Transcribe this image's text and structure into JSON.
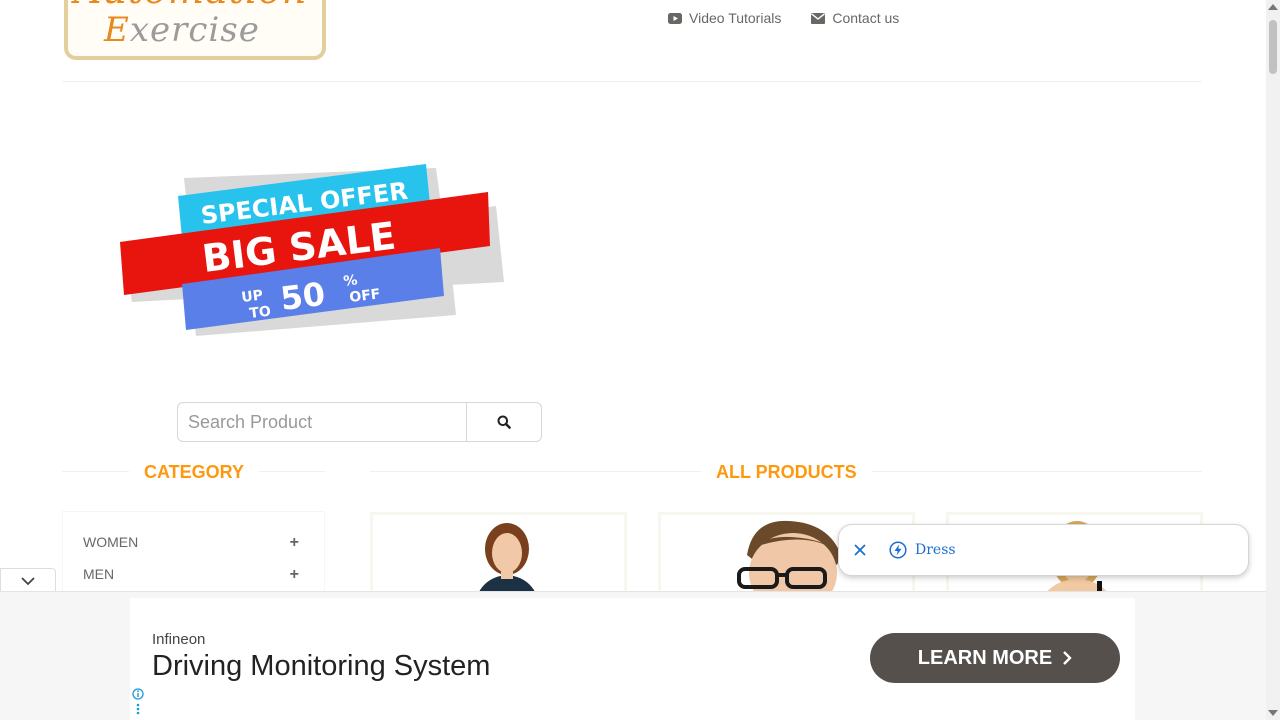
{
  "logo": {
    "line1": "Automation",
    "line2_cap": "E",
    "line2_rest": "xercise"
  },
  "nav": [
    {
      "label": "Video Tutorials",
      "icon": "youtube-icon"
    },
    {
      "label": "Contact us",
      "icon": "envelope-icon"
    }
  ],
  "banner": {
    "line1": "SPECIAL OFFER",
    "line2": "BIG SALE",
    "up": "UP",
    "to": "TO",
    "percent_value": "50",
    "percent_sign": "%",
    "off": "OFF"
  },
  "search": {
    "placeholder": "Search Product",
    "value": ""
  },
  "category": {
    "title": "CATEGORY",
    "items": [
      {
        "label": "WOMEN",
        "toggle": "+"
      },
      {
        "label": "MEN",
        "toggle": "+"
      }
    ]
  },
  "products": {
    "title": "ALL PRODUCTS"
  },
  "suggestion": {
    "text": "Dress"
  },
  "ad": {
    "brand": "Infineon",
    "headline": "Driving Monitoring System",
    "cta": "LEARN MORE"
  },
  "colors": {
    "accent": "#fe980f",
    "ad_button": "#56504d",
    "suggestion_text": "#1a6fd1"
  }
}
